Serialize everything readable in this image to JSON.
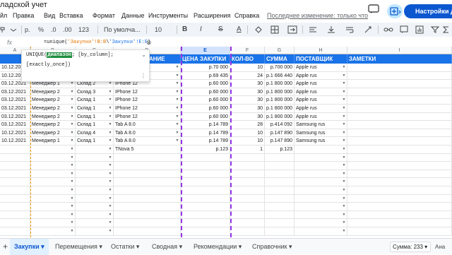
{
  "app": {
    "doc_title": "ладской учет",
    "menu": [
      "йл",
      "Правка",
      "Вид",
      "Вставка",
      "Формат",
      "Данные",
      "Инструменты",
      "Расширения",
      "Справка"
    ],
    "last_edit": "Последнее изменение: только что",
    "settings_label": "Настройки Дом"
  },
  "toolbar": {
    "percent": "%",
    "dec_minus": ".0",
    "dec_plus": ".00",
    "format_123": "123",
    "font_name": "По умолча...",
    "font_size": "10",
    "bold": "B",
    "italic": "I",
    "strike": "S",
    "text_color": "A"
  },
  "formula": {
    "fx": "fx",
    "part1": "=unique(",
    "part2": "'Закупки'!B:B",
    "part3": "\\",
    "part4": "'Закупки'!E:E",
    "part5": ")",
    "hint_close": "⊗"
  },
  "autocomplete": {
    "fn_name": "UNIQUE(",
    "param": "диапазон",
    "rest": "; [by_column];",
    "line2": "[exactly_once])"
  },
  "columns": [
    "A",
    "B",
    "C",
    "D",
    "E",
    "F",
    "G",
    "H",
    "I"
  ],
  "headers": {
    "d": "АНИЕ",
    "e": "ЦЕНА ЗАКУПКИ",
    "f": "КОЛ-ВО",
    "g": "СУММА",
    "h": "ПОСТАВЩИК",
    "i": "ЗАМЕТКИ"
  },
  "rows": [
    {
      "a": "10.12.20",
      "b": "",
      "c": "",
      "d": "",
      "e": "р.70 000",
      "f": "10",
      "g": "р.700 000",
      "h": "Apple rus"
    },
    {
      "a": "10.12.20",
      "b": "",
      "c": "",
      "d": "",
      "e": "р.69 435",
      "f": "24",
      "g": "р.1 666 440",
      "h": "Apple rus"
    },
    {
      "a": "03.12.2021",
      "b": "Менеджер 1",
      "c": "Склад 2",
      "d": "IPhone 12",
      "e": "р.60 000",
      "f": "30",
      "g": "р.1 800 000",
      "h": "Apple rus"
    },
    {
      "a": "03.12.2021",
      "b": "Менеджер 2",
      "c": "Склад 3",
      "d": "IPhone 12",
      "e": "р.60 000",
      "f": "30",
      "g": "р.1 800 000",
      "h": "Apple rus"
    },
    {
      "a": "03.12.2021",
      "b": "Менеджер 2",
      "c": "Склад 1",
      "d": "IPhone 12",
      "e": "р.60 000",
      "f": "30",
      "g": "р.1 800 000",
      "h": "Apple rus"
    },
    {
      "a": "03.12.2021",
      "b": "Менеджер 2",
      "c": "Склад 1",
      "d": "IPhone 12",
      "e": "р.60 000",
      "f": "30",
      "g": "р.1 800 000",
      "h": "Apple rus"
    },
    {
      "a": "03.12.2021",
      "b": "Менеджер 2",
      "c": "Склад 1",
      "d": "IPhone 12",
      "e": "р.60 000",
      "f": "30",
      "g": "р.1 800 000",
      "h": "Apple rus"
    },
    {
      "a": "03.12.2021",
      "b": "Менеджер 2",
      "c": "Склад 1",
      "d": "Tab A 8.0",
      "e": "р.14 789",
      "f": "28",
      "g": "р.414 092",
      "h": "Samsung rus"
    },
    {
      "a": "10.12.2021",
      "b": "Менеджер 2",
      "c": "Склад 4",
      "d": "Tab A 8.0",
      "e": "р.14 789",
      "f": "10",
      "g": "р.147 890",
      "h": "Samsung rus"
    },
    {
      "a": "10.12.2021",
      "b": "Менеджер 1",
      "c": "Склад 1",
      "d": "Tab A 8.0",
      "e": "р.14 789",
      "f": "10",
      "g": "р.147 890",
      "h": "Samsung rus"
    },
    {
      "a": "",
      "b": "",
      "c": "",
      "d": "TNova 5",
      "e": "р.123",
      "f": "1",
      "g": "р.123",
      "h": ""
    }
  ],
  "tabs": [
    "Закупки",
    "Перемещения",
    "Остатки",
    "Сводная",
    "Рекомендации",
    "Справочник"
  ],
  "status": {
    "sum": "Сумма: 233",
    "explore": "Ана"
  },
  "colors": {
    "header_blue": "#1a73e8",
    "accent": "#0b57d0",
    "dashed_orange": "#f29900",
    "dashed_purple": "#9334e6"
  }
}
